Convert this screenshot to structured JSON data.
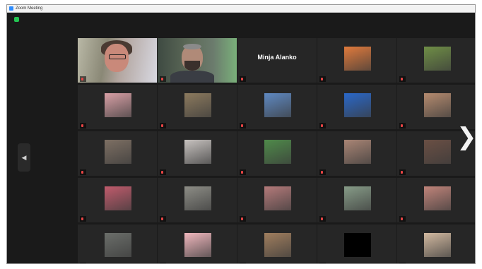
{
  "window": {
    "title": "Zoom Meeting"
  },
  "nav": {
    "prev_glyph": "◀",
    "next_glyph": "❯"
  },
  "status": {
    "text": ""
  },
  "participants": [
    {
      "name": "",
      "kind": "video-woman",
      "active": true,
      "color": "#c9897a"
    },
    {
      "name": "",
      "kind": "video-man",
      "active": false,
      "color": "#b08a78"
    },
    {
      "name": "Minja Alanko",
      "kind": "name",
      "active": false,
      "color": "#262626"
    },
    {
      "name": "",
      "kind": "photo",
      "active": false,
      "color": "#e07a3c"
    },
    {
      "name": "",
      "kind": "photo",
      "active": false,
      "color": "#6f8e46"
    },
    {
      "name": "",
      "kind": "photo",
      "active": false,
      "color": "#d9a0a6"
    },
    {
      "name": "",
      "kind": "photo",
      "active": false,
      "color": "#8c7a5e"
    },
    {
      "name": "",
      "kind": "photo",
      "active": false,
      "color": "#5f89c2"
    },
    {
      "name": "",
      "kind": "photo",
      "active": false,
      "color": "#2a68c9"
    },
    {
      "name": "",
      "kind": "photo",
      "active": false,
      "color": "#b58b6f"
    },
    {
      "name": "",
      "kind": "photo",
      "active": false,
      "color": "#7d6f63"
    },
    {
      "name": "",
      "kind": "photo",
      "active": false,
      "color": "#c7c2bf"
    },
    {
      "name": "",
      "kind": "photo",
      "active": false,
      "color": "#4f8a4a"
    },
    {
      "name": "",
      "kind": "photo",
      "active": false,
      "color": "#a98575"
    },
    {
      "name": "",
      "kind": "photo",
      "active": false,
      "color": "#6a4f44"
    },
    {
      "name": "",
      "kind": "photo",
      "active": false,
      "color": "#c05b6c"
    },
    {
      "name": "",
      "kind": "photo",
      "active": false,
      "color": "#8d8d86"
    },
    {
      "name": "",
      "kind": "photo",
      "active": false,
      "color": "#b47a7a"
    },
    {
      "name": "",
      "kind": "photo",
      "active": false,
      "color": "#879c88"
    },
    {
      "name": "",
      "kind": "photo",
      "active": false,
      "color": "#c0847a"
    },
    {
      "name": "",
      "kind": "photo",
      "active": false,
      "color": "#6b6e6a"
    },
    {
      "name": "",
      "kind": "photo",
      "active": false,
      "color": "#f0b7bd"
    },
    {
      "name": "",
      "kind": "photo",
      "active": false,
      "color": "#a07e5e"
    },
    {
      "name": "",
      "kind": "black",
      "active": false,
      "color": "#000000"
    },
    {
      "name": "",
      "kind": "photo",
      "active": false,
      "color": "#d2b9a0"
    }
  ]
}
